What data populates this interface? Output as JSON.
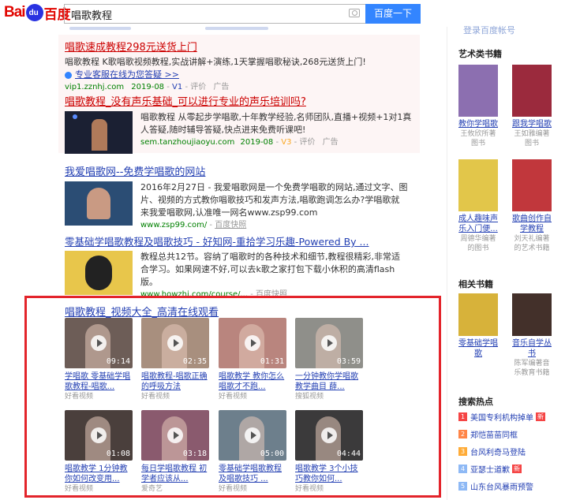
{
  "header": {
    "logo_text_bai": "Bai",
    "logo_text_paw": "du",
    "logo_text_du": "百度",
    "search_value": "唱歌教程",
    "search_button": "百度一下"
  },
  "results": [
    {
      "title": "唱歌速成教程298元送货上门",
      "text1": "唱歌教程 K歌唱歌视频教程,实战讲解+演练,1天掌握唱歌秘诀,268元送货上门!",
      "link": "专业客服在线为您答疑 >>",
      "url": "vip1.zznhj.com",
      "date": "2019-08",
      "v": "V1",
      "review": "评价",
      "ad": "广告"
    },
    {
      "title": "唱歌教程_没有声乐基础_可以进行专业的声乐培训吗?",
      "text1": "唱歌教程 从零起步学唱歌,十年教学经验,名师团队,直播+视频+1对1真",
      "text2": "人答疑,随时辅导答疑,快点进来免费听课吧!",
      "url": "sem.tanzhoujiaoyu.com",
      "date": "2019-08",
      "v": "V3",
      "review": "评价",
      "ad": "广告"
    },
    {
      "title": "我爱唱歌网--免费学唱歌的网站",
      "text1": "2016年2月27日 - 我爱唱歌网是一个免费学唱歌的网站,通过文字、图",
      "text2": "片、视频的方式教你唱歌技巧和发声方法,唱歌跑调怎么办?学唱歌就",
      "text3": "来我爱唱歌网,认准唯一网名www.zsp99.com",
      "url": "www.zsp99.com/",
      "snapshot": "百度快照"
    },
    {
      "title": "零基础学唱歌教程及唱歌技巧 - 好知网-重拾学习乐趣-Powered By ...",
      "text1": "教程总共12节。容纳了唱歌时的各种技术和细节,教程很精彩,非常适",
      "text2": "合学习。如果网速不好,可以去k歌之家打包下载小休积的高清flash",
      "text3": "版。",
      "url": "www.howzhi.com/course/...",
      "snapshot": "百度快照"
    }
  ],
  "video_block": {
    "title": "唱歌教程_视频大全_高清在线观看",
    "videos": [
      {
        "duration": "09:14",
        "title": "学唱歌 零基础学唱歌教程-唱歌...",
        "source": "好看视频",
        "color": "#6d5d57"
      },
      {
        "duration": "02:35",
        "title": "唱歌教程-唱歌正确的呼吸方法",
        "source": "好看视频",
        "color": "#a88f7e"
      },
      {
        "duration": "01:31",
        "title": "唱歌教学 教你怎么唱歌才不跑...",
        "source": "好看视频",
        "color": "#b9857e"
      },
      {
        "duration": "03:59",
        "title": "一分钟教你学唱歌 教学曲目 薛...",
        "source": "搜狐视频",
        "color": "#8f8f8a"
      },
      {
        "duration": "01:08",
        "title": "唱歌教学 1分钟教你如何改变用...",
        "source": "好看视频",
        "color": "#4a3f3c"
      },
      {
        "duration": "03:18",
        "title": "每日学唱歌教程 初学者应该从...",
        "source": "爱奇艺",
        "color": "#8a5a6e"
      },
      {
        "duration": "05:00",
        "title": "零基础学唱歌教程及唱歌技巧 ...",
        "source": "好看视频",
        "color": "#6d7f8c"
      },
      {
        "duration": "04:44",
        "title": "唱歌教学 3个小技巧教你如何...",
        "source": "好看视频",
        "color": "#3b3a3b"
      }
    ]
  },
  "sidebar": {
    "top_text": "登录百度帐号",
    "books_heading": "艺术类书籍",
    "books": [
      {
        "title": "教你学唱歌",
        "sub": "王攸欣所著图书",
        "color": "#8c6fb0"
      },
      {
        "title": "跟我学唱歌",
        "sub": "王如雅编著图书",
        "color": "#9b2a3d"
      },
      {
        "title": "成人趣味声乐入门便...",
        "sub": "周德华编著的图书",
        "color": "#e2c64a"
      },
      {
        "title": "歌曲创作自学教程",
        "sub": "刘天礼编著的艺术书籍",
        "color": "#c1373c"
      }
    ],
    "related_heading": "相关书籍",
    "related": [
      {
        "title": "零基础学唱歌",
        "sub": "",
        "color": "#d7b23a"
      },
      {
        "title": "音乐自学丛书",
        "sub": "陈军编著音乐教育书籍",
        "color": "#43302a"
      }
    ],
    "hot_heading": "搜索热点",
    "hot": [
      {
        "num": "1",
        "text": "美国专利机构掉单",
        "badge": "新",
        "color": "#f54545"
      },
      {
        "num": "2",
        "text": "郑恺苗苗同框",
        "badge": "",
        "color": "#ff8547"
      },
      {
        "num": "3",
        "text": "台风利奇马登陆",
        "badge": "",
        "color": "#ffac38"
      },
      {
        "num": "4",
        "text": "亚瑟士道歉",
        "badge": "新",
        "color": "#8eb9f5"
      },
      {
        "num": "5",
        "text": "山东台风暴雨预警",
        "badge": "",
        "color": "#8eb9f5"
      }
    ]
  }
}
